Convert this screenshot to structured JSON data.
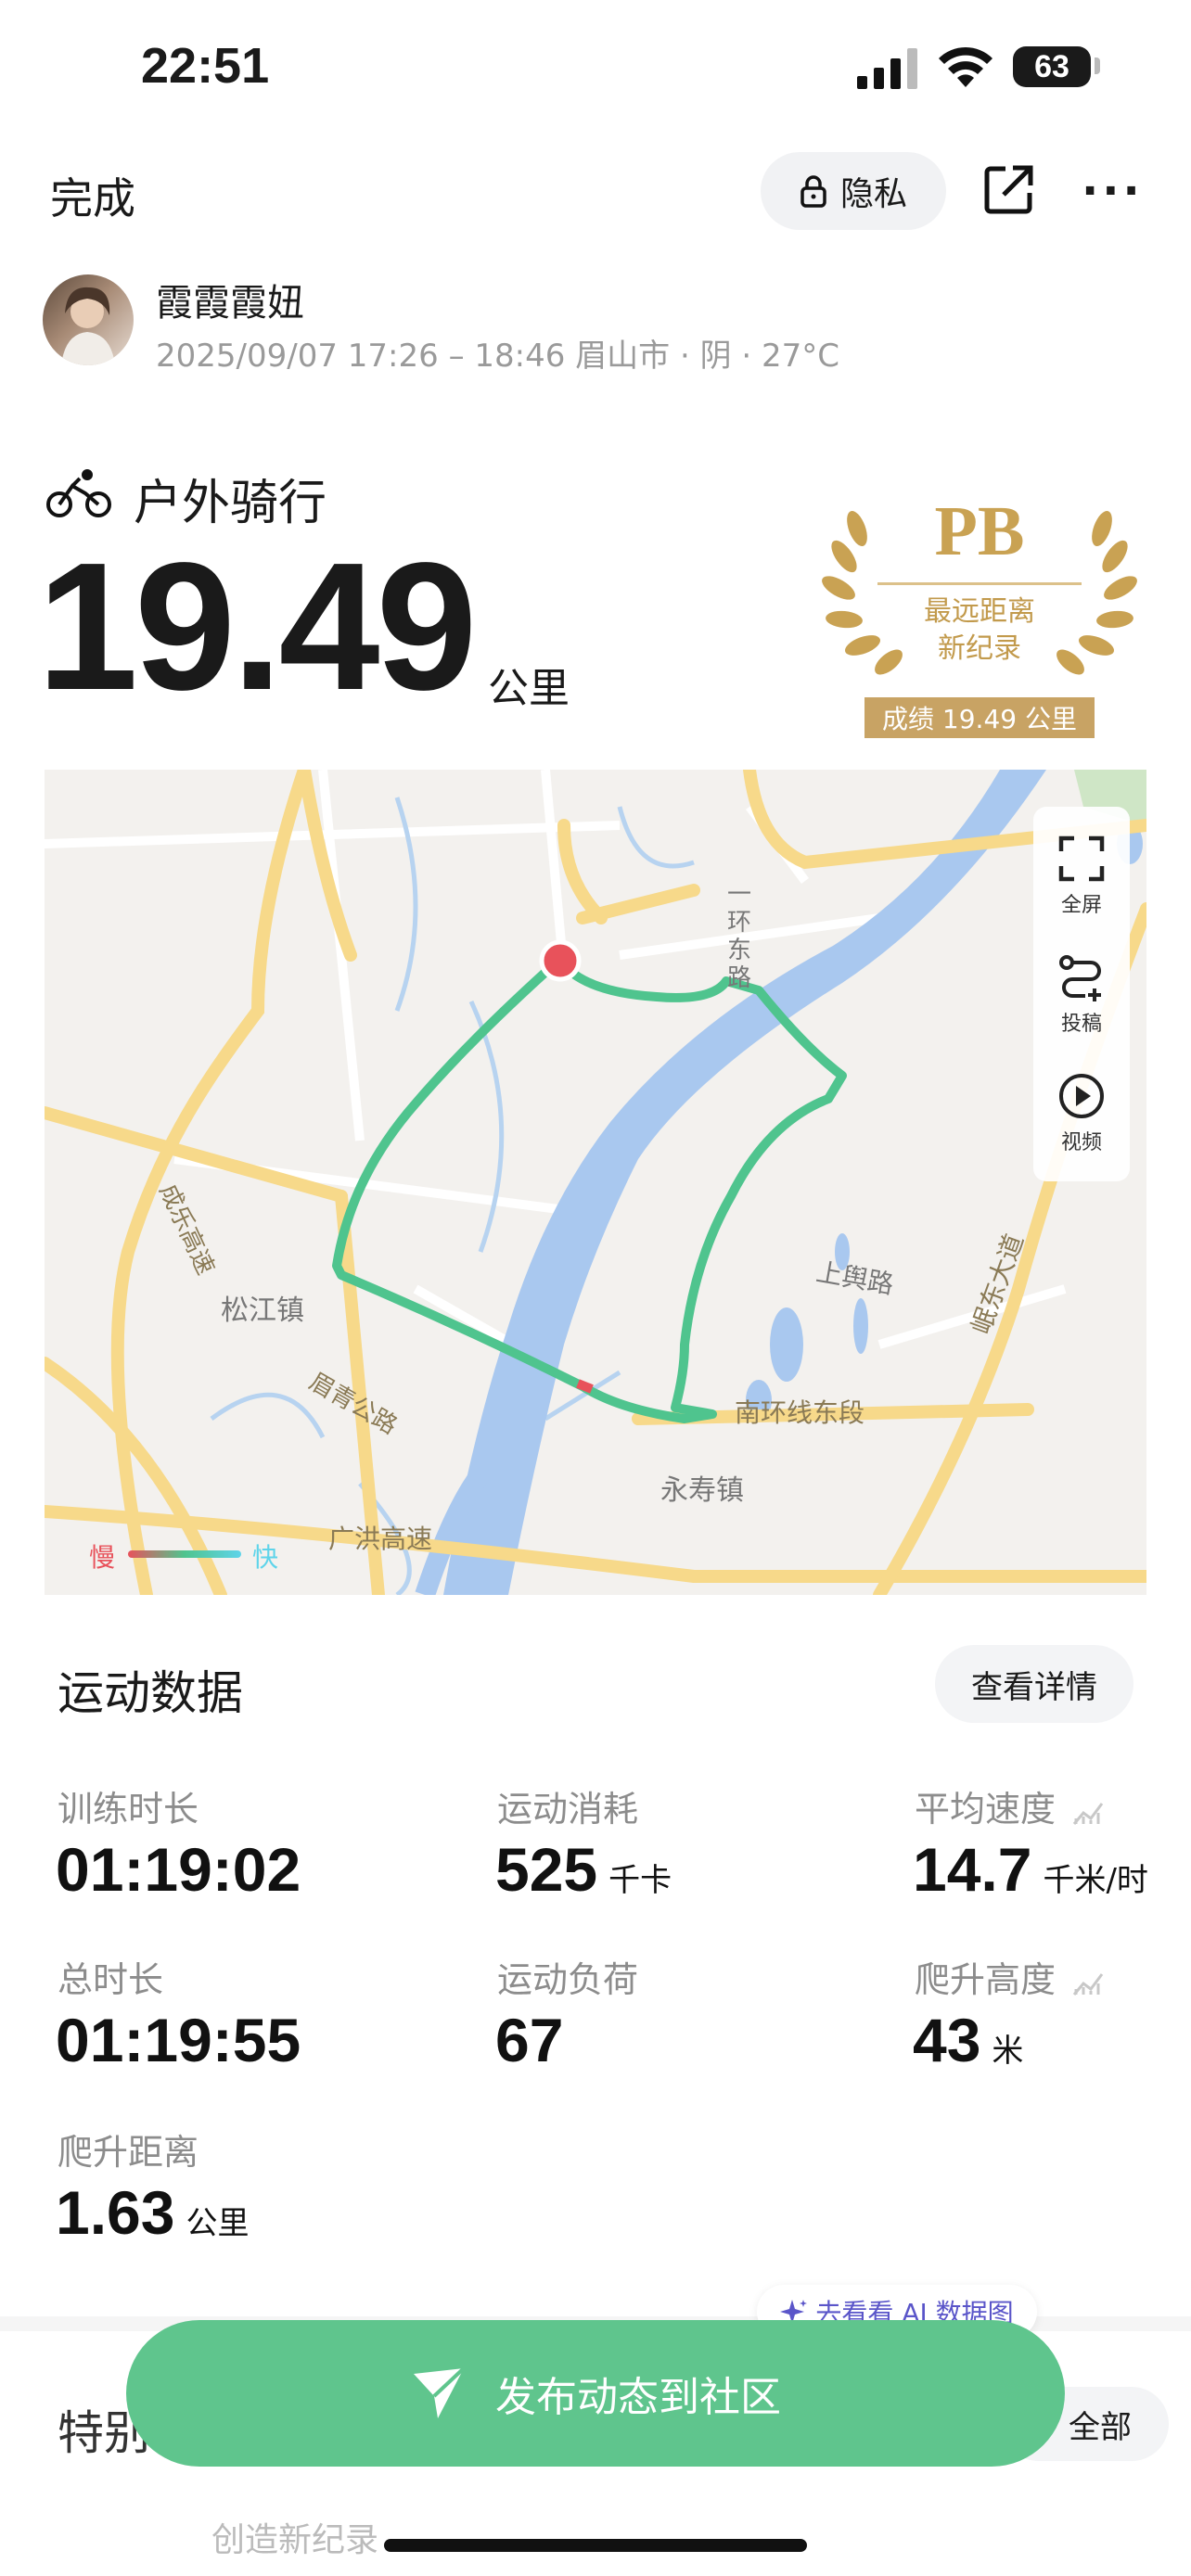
{
  "status": {
    "time": "22:51",
    "battery": "63"
  },
  "header": {
    "done_label": "完成",
    "privacy_label": "隐私"
  },
  "user": {
    "name": "霞霞霞妞",
    "meta": "2025/09/07 17:26 – 18:46 眉山市 · 阴 · 27°C"
  },
  "activity": {
    "type": "户外骑行",
    "distance": "19.49",
    "unit": "公里"
  },
  "pb": {
    "title": "PB",
    "line1": "最远距离",
    "line2": "新纪录",
    "badge": "成绩 19.49 公里"
  },
  "map": {
    "tools": [
      {
        "label": "全屏",
        "icon": "fullscreen-icon"
      },
      {
        "label": "投稿",
        "icon": "route-icon"
      },
      {
        "label": "视频",
        "icon": "play-icon"
      }
    ],
    "labels": {
      "ring_road": "一环东路",
      "songjiang": "松江镇",
      "chengle": "成乐高速",
      "meiqing": "眉青公路",
      "guanghong": "广洪高速",
      "yongshou": "永寿镇",
      "nanhuan": "南环线东段",
      "shangyu": "上舆路",
      "mindong": "岷东大道"
    },
    "legend": {
      "slow": "慢",
      "fast": "快"
    },
    "colors": {
      "route": "#4fc48e",
      "slow": "#e8525b",
      "fast": "#5ed4ea",
      "river": "#a9c8ef",
      "road": "#f7d98a"
    }
  },
  "stats": {
    "title": "运动数据",
    "detail_label": "查看详情",
    "items": [
      {
        "label": "训练时长",
        "value": "01:19:02",
        "unit": ""
      },
      {
        "label": "运动消耗",
        "value": "525",
        "unit": "千卡"
      },
      {
        "label": "平均速度",
        "value": "14.7",
        "unit": "千米/时"
      },
      {
        "label": "总时长",
        "value": "01:19:55",
        "unit": ""
      },
      {
        "label": "运动负荷",
        "value": "67",
        "unit": ""
      },
      {
        "label": "爬升高度",
        "value": "43",
        "unit": "米"
      },
      {
        "label": "爬升距离",
        "value": "1.63",
        "unit": "公里"
      }
    ]
  },
  "bottom": {
    "section_partial": "特别",
    "all_partial": "全部",
    "sub_partial": "创造新纪录",
    "ai_chip": "去看看 AI 数据图",
    "publish_label": "发布动态到社区"
  }
}
